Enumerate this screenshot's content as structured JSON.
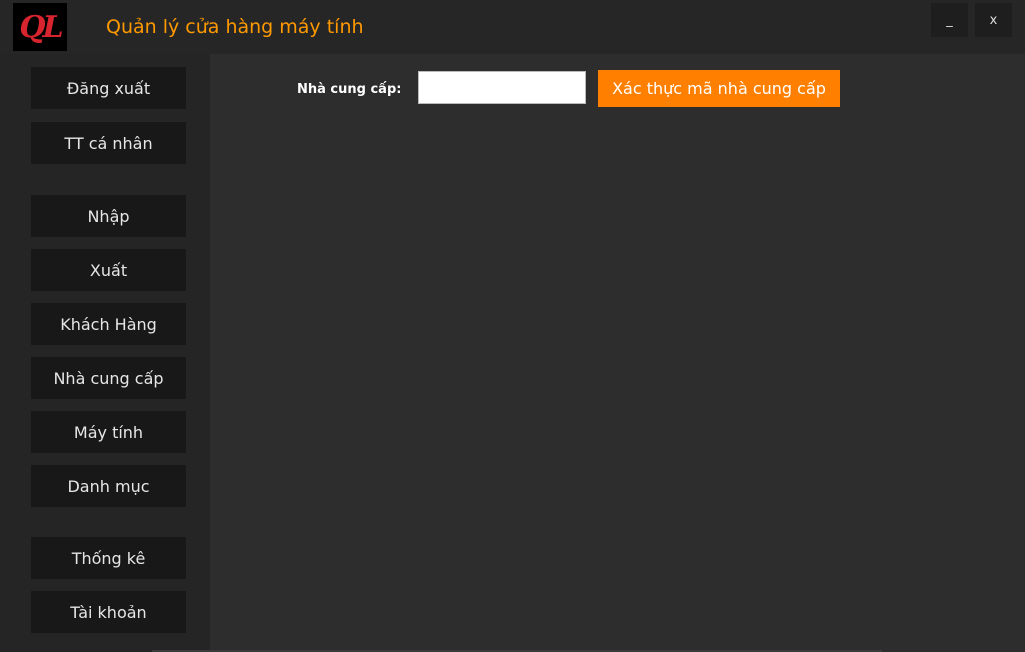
{
  "window": {
    "logo_text": "QL",
    "title": "Quản lý cửa hàng máy tính",
    "minimize_label": "_",
    "close_label": "x"
  },
  "sidebar": {
    "items": [
      {
        "label": "Đăng xuất"
      },
      {
        "label": "TT cá nhân"
      },
      {
        "label": "Nhập"
      },
      {
        "label": "Xuất"
      },
      {
        "label": "Khách Hàng"
      },
      {
        "label": "Nhà cung cấp"
      },
      {
        "label": "Máy tính"
      },
      {
        "label": "Danh mục"
      },
      {
        "label": "Thống kê"
      },
      {
        "label": "Tài khoản"
      }
    ]
  },
  "main": {
    "supplier_label": "Nhà cung cấp:",
    "supplier_value": "",
    "verify_button": "Xác thực mã nhà cung cấp"
  },
  "colors": {
    "accent": "#ff8000",
    "title_color": "#ff9900",
    "logo_red": "#d7242f"
  }
}
